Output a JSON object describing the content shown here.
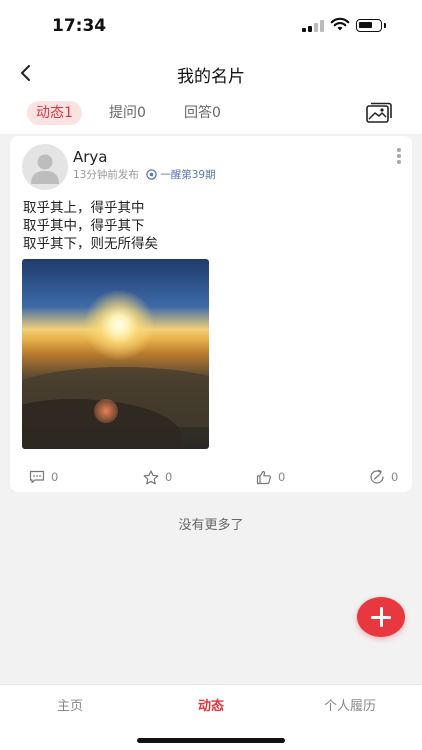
{
  "status_bar": {
    "time": "17:34"
  },
  "nav": {
    "title": "我的名片"
  },
  "tabs": [
    {
      "label": "动态1",
      "active": true
    },
    {
      "label": "提问0",
      "active": false
    },
    {
      "label": "回答0",
      "active": false
    }
  ],
  "post": {
    "author": "Arya",
    "time": "13分钟前发布",
    "tag": "一醒第39期",
    "lines": [
      "取乎其上，得乎其中",
      "取乎其中，得乎其下",
      "取乎其下，则无所得矣"
    ],
    "actions": {
      "comments": "0",
      "favorites": "0",
      "likes": "0",
      "shares": "0"
    }
  },
  "no_more_text": "没有更多了",
  "tabbar": {
    "items": [
      "主页",
      "动态",
      "个人履历"
    ],
    "active_index": 1
  },
  "colors": {
    "accent": "#e0353d",
    "tag": "#5a76b0"
  }
}
